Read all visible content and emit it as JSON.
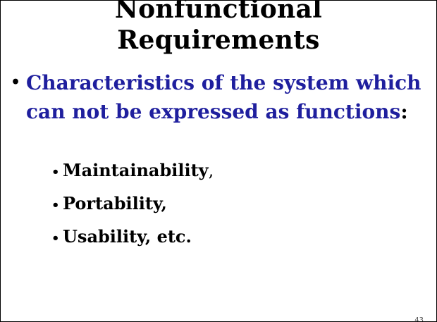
{
  "slide": {
    "title_line1": "Nonfunctional",
    "title_line2": "Requirements",
    "main_bullet_marker": "•",
    "main_bullet_text": "Characteristics of the system which can not be expressed as functions",
    "main_bullet_suffix": ":",
    "sub_bullet_marker": "•",
    "sub_bullets": [
      {
        "text": "Maintainability",
        "suffix": ","
      },
      {
        "text": "Portability,",
        "suffix": ""
      },
      {
        "text": "Usability, etc.",
        "suffix": ""
      }
    ],
    "page_number": "43"
  },
  "colors": {
    "main_bullet_text": "#1f1f9e",
    "title": "#000000",
    "background": "#ffffff"
  }
}
